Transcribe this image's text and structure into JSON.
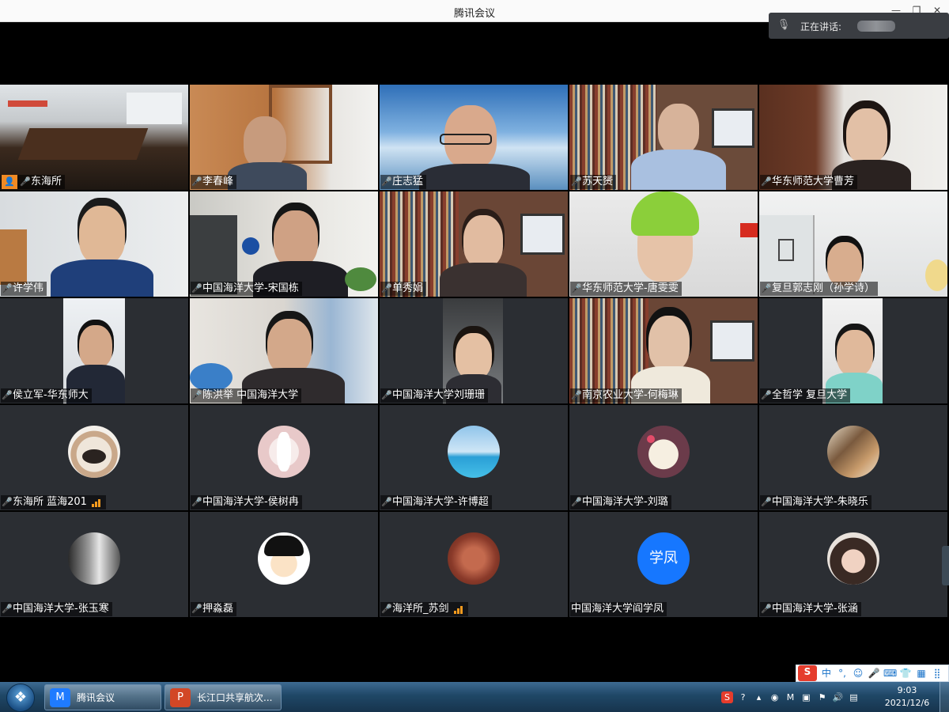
{
  "window": {
    "title": "腾讯会议"
  },
  "speaking": {
    "label": "正在讲话:"
  },
  "tiles": [
    {
      "name": "东海所",
      "mic": "on",
      "host": true
    },
    {
      "name": "李春峰",
      "mic": "on"
    },
    {
      "name": "庄志猛",
      "mic": "active"
    },
    {
      "name": "苏天赟",
      "mic": "muted"
    },
    {
      "name": "华东师范大学曹芳",
      "mic": "muted"
    },
    {
      "name": "许学伟",
      "mic": "muted"
    },
    {
      "name": "中国海洋大学-宋国栋",
      "mic": "muted"
    },
    {
      "name": "单秀娟",
      "mic": "muted"
    },
    {
      "name": "华东师范大学-唐雯雯",
      "mic": "muted"
    },
    {
      "name": "复旦郭志刚（孙学诗）",
      "mic": "muted"
    },
    {
      "name": "侯立军-华东师大",
      "mic": "muted"
    },
    {
      "name": "陈洪举 中国海洋大学",
      "mic": "muted"
    },
    {
      "name": "中国海洋大学刘珊珊",
      "mic": "muted"
    },
    {
      "name": "南京农业大学-何梅琳",
      "mic": "muted"
    },
    {
      "name": "全哲学 复旦大学",
      "mic": "muted"
    },
    {
      "name": "东海所 蓝海201",
      "mic": "muted",
      "signal": true
    },
    {
      "name": "中国海洋大学-侯树冉",
      "mic": "muted"
    },
    {
      "name": "中国海洋大学-许博超",
      "mic": "muted"
    },
    {
      "name": "中国海洋大学-刘璐",
      "mic": "muted"
    },
    {
      "name": "中国海洋大学-朱晓乐",
      "mic": "muted"
    },
    {
      "name": "中国海洋大学-张玉寒",
      "mic": "muted"
    },
    {
      "name": "押淼磊",
      "mic": "muted"
    },
    {
      "name": "海洋所_苏剑",
      "mic": "muted",
      "signal": true
    },
    {
      "name": "中国海洋大学阎学凤",
      "mic": "none",
      "avatar_text": "学凤"
    },
    {
      "name": "中国海洋大学-张涵",
      "mic": "muted"
    }
  ],
  "taskbar": {
    "apps": [
      {
        "label": "腾讯会议"
      },
      {
        "label": "长江口共享航次..."
      }
    ],
    "clock": {
      "time": "9:03",
      "date": "2021/12/6"
    }
  },
  "ime": {
    "mode": "中"
  },
  "colors": {
    "accent": "#1677ff",
    "muted_mic": "#e84b4b",
    "active_mic": "#56c86a",
    "signal": "#f39a1e"
  }
}
